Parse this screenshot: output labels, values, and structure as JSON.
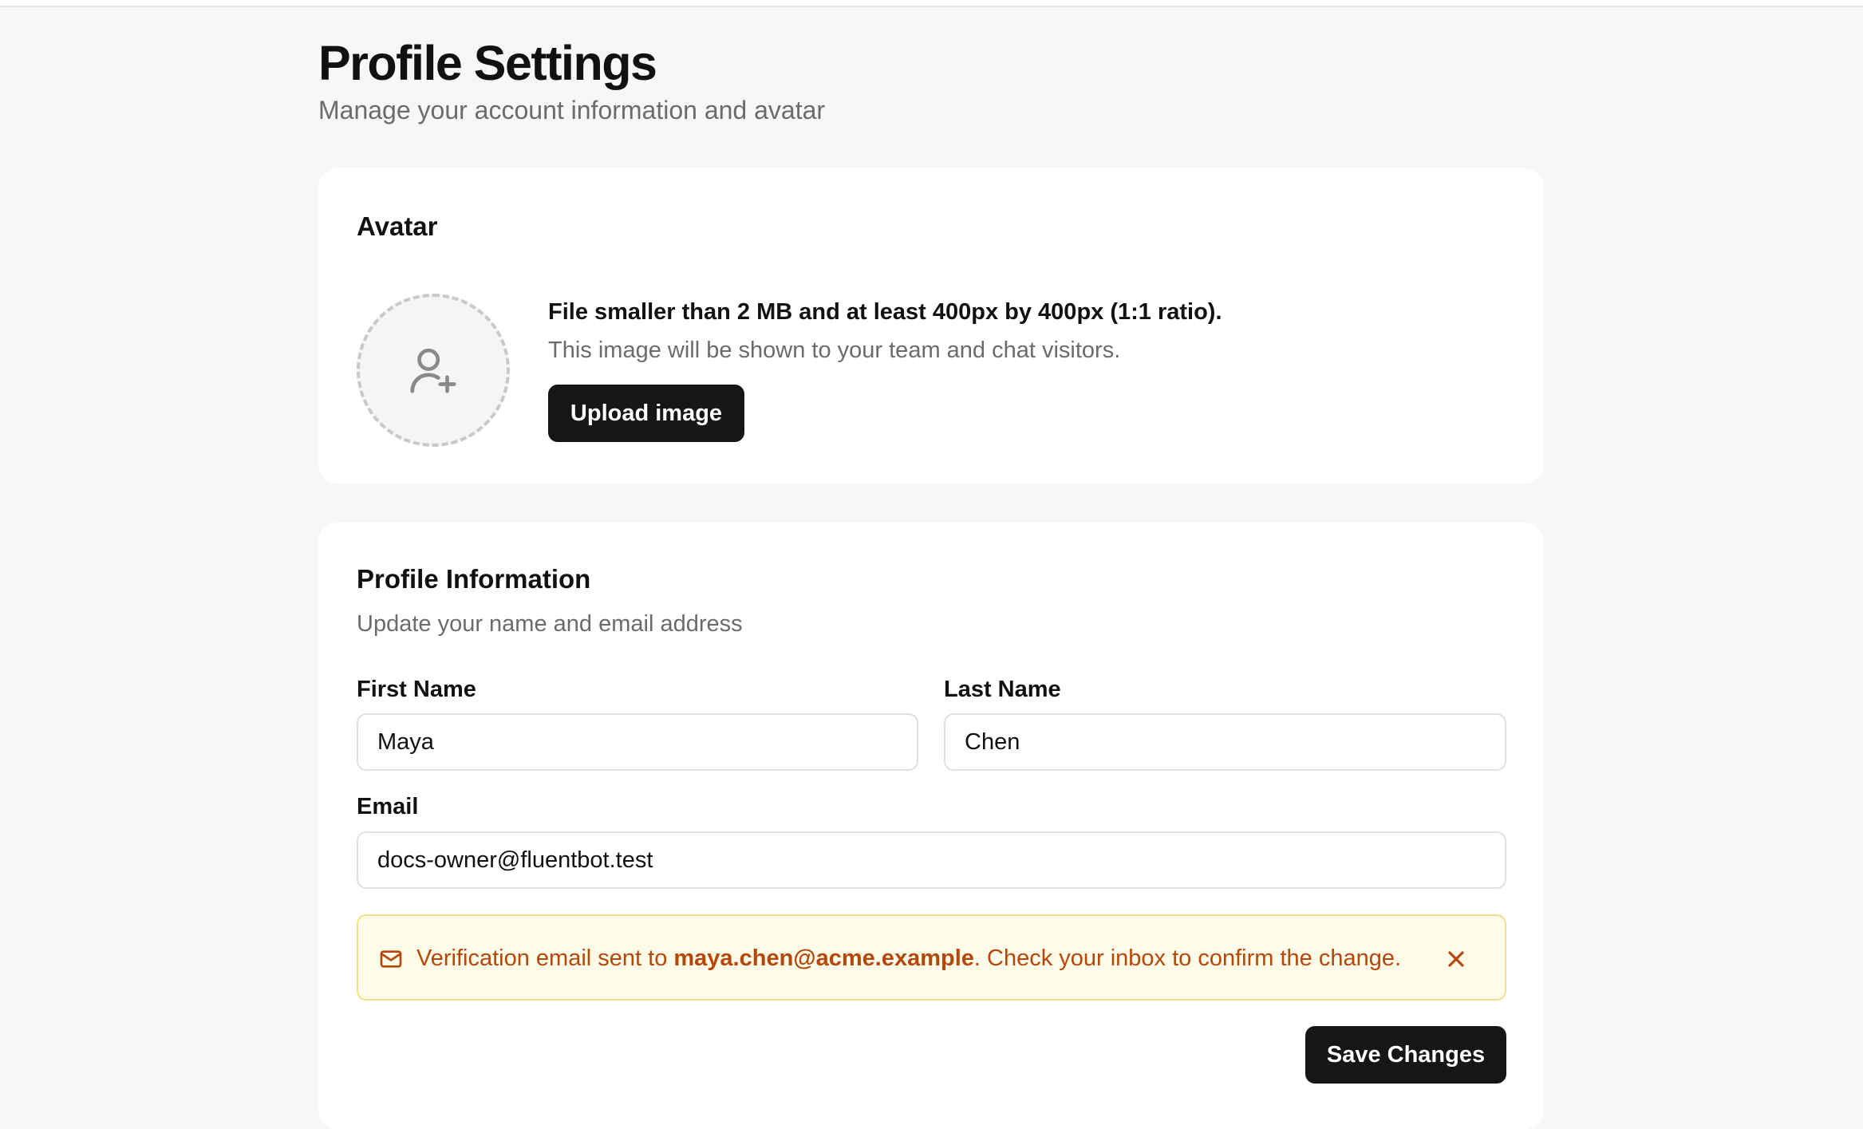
{
  "header": {
    "title": "Profile Settings",
    "subtitle": "Manage your account information and avatar"
  },
  "avatar_card": {
    "heading": "Avatar",
    "placeholder_icon": "user-plus-icon",
    "requirements": "File smaller than 2 MB and at least 400px by 400px (1:1 ratio).",
    "visibility_note": "This image will be shown to your team and chat visitors.",
    "upload_label": "Upload image"
  },
  "profile_card": {
    "heading": "Profile Information",
    "subtitle": "Update your name and email address",
    "first_name": {
      "label": "First Name",
      "value": "Maya"
    },
    "last_name": {
      "label": "Last Name",
      "value": "Chen"
    },
    "email": {
      "label": "Email",
      "value": "docs-owner@fluentbot.test"
    },
    "alert": {
      "icon": "mail-icon",
      "prefix": "Verification email sent to ",
      "address": "maya.chen@acme.example",
      "suffix": ". Check your inbox to confirm the change.",
      "close_icon": "close-icon"
    },
    "save_label": "Save Changes"
  },
  "colors": {
    "page_background": "#f6f7f9",
    "card_background": "#ffffff",
    "primary_button": "#161616",
    "alert_background": "#fefbe9",
    "alert_border": "#f2dd8a",
    "alert_text": "#b54708",
    "muted_text": "#6b6b6b"
  }
}
